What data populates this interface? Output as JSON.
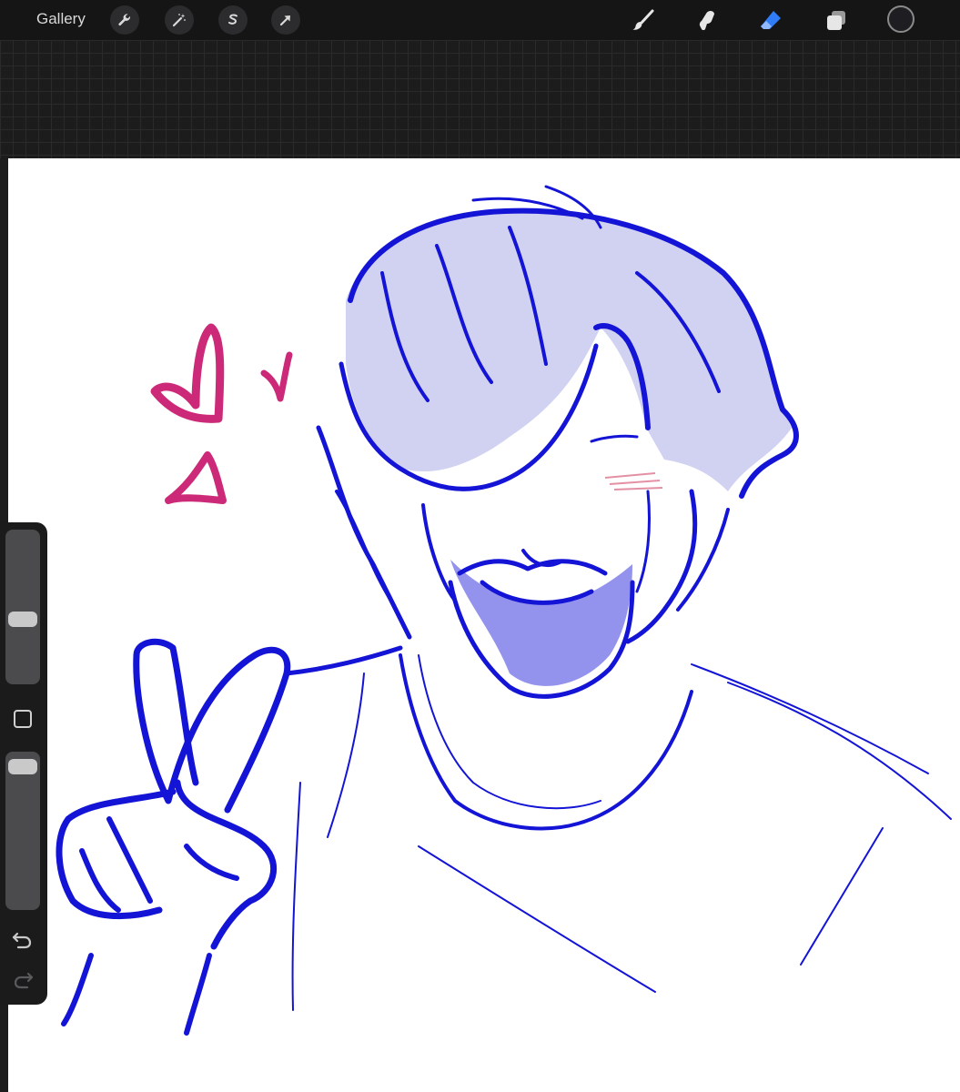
{
  "toolbar": {
    "gallery_label": "Gallery",
    "left_tools": [
      {
        "name": "wrench-icon"
      },
      {
        "name": "magic-wand-icon"
      },
      {
        "name": "selection-s-icon"
      },
      {
        "name": "move-arrow-icon"
      }
    ],
    "right_tools": [
      {
        "name": "brush-icon",
        "active": false
      },
      {
        "name": "smudge-icon",
        "active": false
      },
      {
        "name": "eraser-icon",
        "active": true
      },
      {
        "name": "layers-icon",
        "active": false
      }
    ],
    "active_color": "#1e1e22",
    "accent_color": "#2f7cf6"
  },
  "sidebar": {
    "brush_size": 0.41,
    "opacity": 0.97,
    "controls": [
      "modify-button",
      "undo-arrow-icon",
      "redo-arrow-icon"
    ]
  },
  "canvas": {
    "ink_color": "#1414d6",
    "heart_color": "#cc2a78",
    "hair_fill": "#c9c9ef"
  }
}
